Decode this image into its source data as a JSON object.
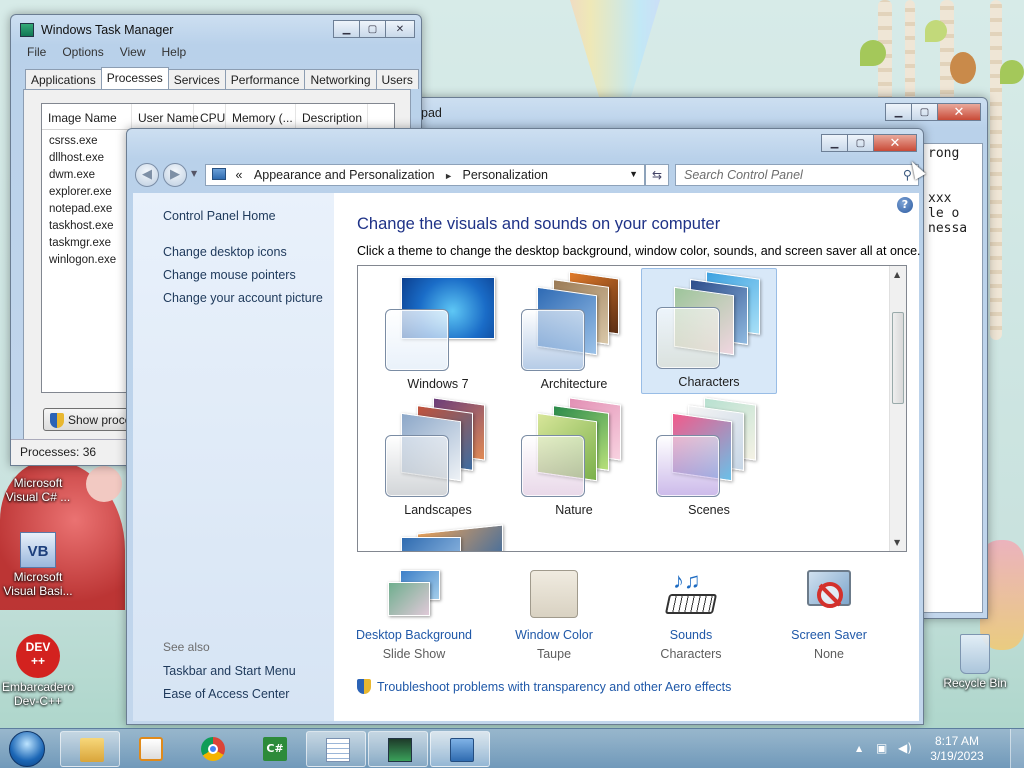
{
  "taskmgr": {
    "title": "Windows Task Manager",
    "menu": [
      "File",
      "Options",
      "View",
      "Help"
    ],
    "tabs": [
      "Applications",
      "Processes",
      "Services",
      "Performance",
      "Networking",
      "Users"
    ],
    "columns": [
      "Image Name",
      "User Name",
      "CPU",
      "Memory (...",
      "Description"
    ],
    "processes": [
      "csrss.exe",
      "dllhost.exe",
      "dwm.exe",
      "explorer.exe",
      "notepad.exe",
      "taskhost.exe",
      "taskmgr.exe",
      "winlogon.exe"
    ],
    "show_button": "Show processes from all users",
    "status": "Processes: 36"
  },
  "notepad": {
    "title_fragment": "pad",
    "lines": "rong\n\n\nxxx\nle o\nnessa"
  },
  "cp": {
    "address": {
      "chevron": "«",
      "crumb1": "Appearance and Personalization",
      "sep": "►",
      "crumb2": "Personalization"
    },
    "search_placeholder": "Search Control Panel",
    "left": {
      "home": "Control Panel Home",
      "links": [
        "Change desktop icons",
        "Change mouse pointers",
        "Change your account picture"
      ],
      "see_also": "See also",
      "see_also_links": [
        "Taskbar and Start Menu",
        "Ease of Access Center"
      ]
    },
    "heading": "Change the visuals and sounds on your computer",
    "subheading": "Click a theme to change the desktop background, window color, sounds, and screen saver all at once.",
    "themes": [
      "Windows 7",
      "Architecture",
      "Characters",
      "Landscapes",
      "Nature",
      "Scenes"
    ],
    "selected_theme": "Characters",
    "bottom": [
      {
        "title": "Desktop Background",
        "value": "Slide Show",
        "icon": "desktop-background-icon"
      },
      {
        "title": "Window Color",
        "value": "Taupe",
        "icon": "window-color-icon"
      },
      {
        "title": "Sounds",
        "value": "Characters",
        "icon": "sounds-icon"
      },
      {
        "title": "Screen Saver",
        "value": "None",
        "icon": "screen-saver-icon"
      }
    ],
    "troubleshoot": "Troubleshoot problems with transparency and other Aero effects"
  },
  "desktop": {
    "icons": [
      {
        "label": "Microsoft Visual C# ...",
        "icon": "visual-csharp-icon"
      },
      {
        "label": "Microsoft Visual Basi...",
        "icon": "visual-basic-icon"
      },
      {
        "label": "Embarcadero Dev-C++",
        "icon": "devcpp-icon"
      },
      {
        "label": "Recycle Bin",
        "icon": "recycle-bin-icon"
      }
    ]
  },
  "taskbar": {
    "time": "8:17 AM",
    "date": "3/19/2023",
    "colors": {
      "accent": "#1f58a8",
      "heading": "#1e3287"
    }
  }
}
